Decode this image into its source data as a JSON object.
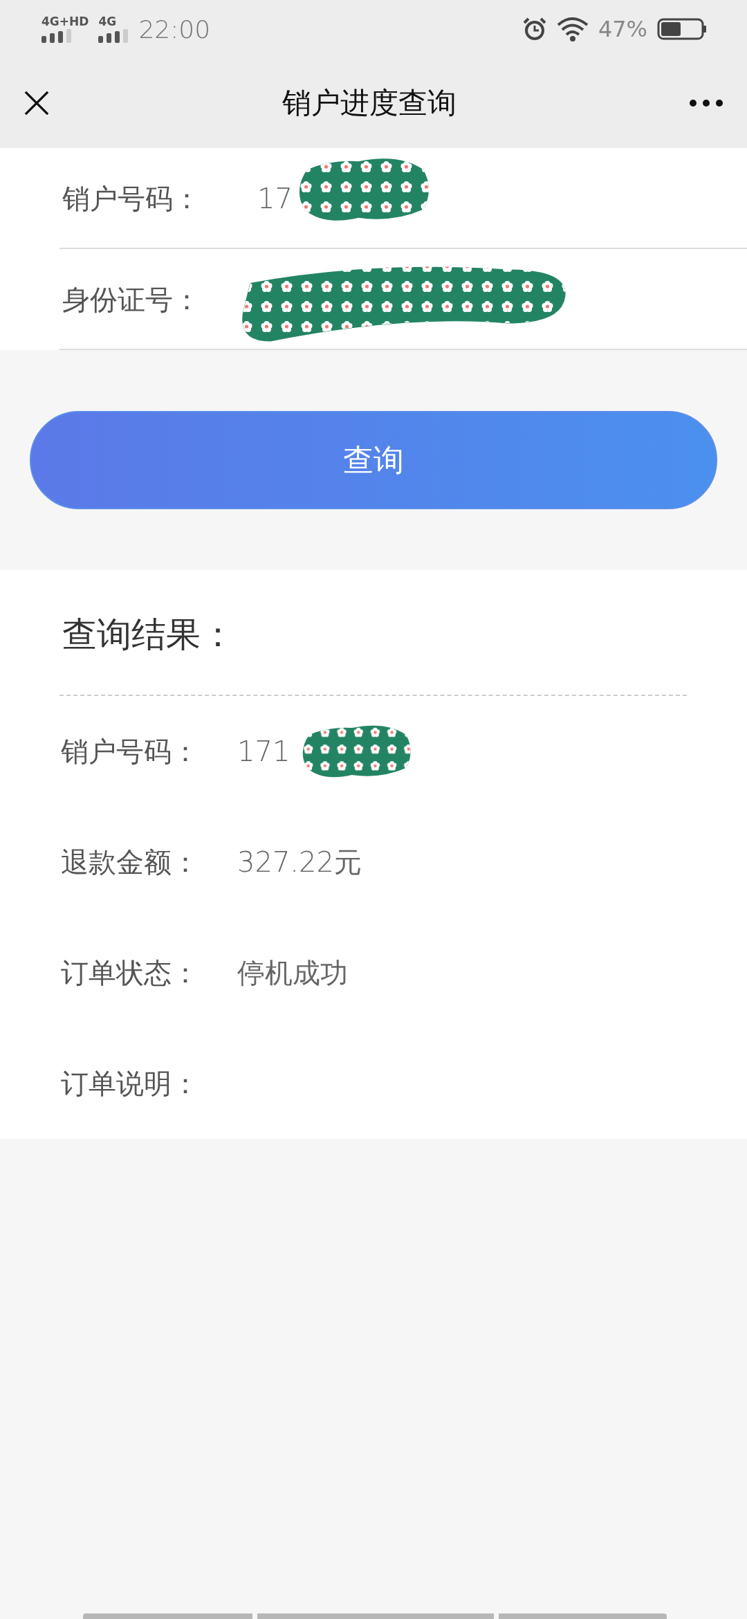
{
  "status_bar": {
    "network_1": "4G+HD",
    "network_2": "4G",
    "time": "22:00",
    "battery": "47%"
  },
  "nav_bar": {
    "title": "销户进度查询"
  },
  "form": {
    "fields": [
      {
        "label": "销户号码：",
        "value": "17",
        "covered": true
      },
      {
        "label": "身份证号：",
        "covered": true
      }
    ]
  },
  "query_button": "查询",
  "results": {
    "title": "查询结果：",
    "rows": [
      {
        "label": "销户号码：",
        "value": "171",
        "covered": true
      },
      {
        "label": "退款金额：",
        "value": "327.22元"
      },
      {
        "label": "订单状态：",
        "value": "停机成功"
      },
      {
        "label": "订单说明："
      }
    ]
  }
}
